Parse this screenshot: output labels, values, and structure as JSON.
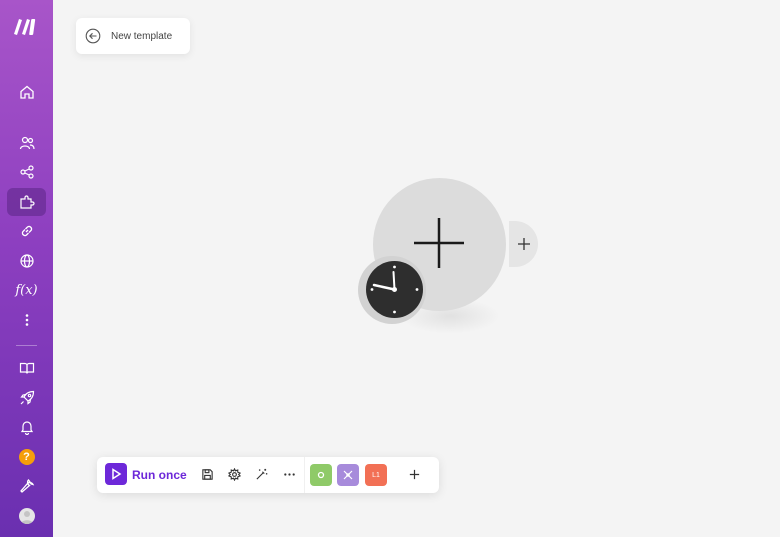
{
  "header": {
    "back_card_title": "New template"
  },
  "sidebar": {
    "items": [
      {
        "name": "home",
        "icon": "home-icon"
      },
      {
        "name": "team",
        "icon": "users-icon"
      },
      {
        "name": "scenarios",
        "icon": "share-icon"
      },
      {
        "name": "templates",
        "icon": "puzzle-icon",
        "active": true
      },
      {
        "name": "connections",
        "icon": "link-icon"
      },
      {
        "name": "webhooks",
        "icon": "globe-icon"
      },
      {
        "name": "functions",
        "icon": "function-icon",
        "label": "f(x)"
      },
      {
        "name": "more",
        "icon": "more-vertical-icon"
      },
      {
        "name": "docs",
        "icon": "book-icon"
      },
      {
        "name": "whats-new",
        "icon": "rocket-icon"
      },
      {
        "name": "notifications",
        "icon": "bell-icon"
      },
      {
        "name": "help",
        "icon": "help-icon",
        "label": "?"
      },
      {
        "name": "settings",
        "icon": "wrench-icon"
      },
      {
        "name": "profile",
        "icon": "avatar-icon"
      }
    ]
  },
  "toolbar": {
    "run_once_label": "Run once",
    "tags": [
      "",
      "",
      "L1"
    ]
  },
  "colors": {
    "accent": "#6d28d9",
    "tag_green": "#8fca68",
    "tag_purple": "#a78bdb",
    "tag_orange": "#f27055"
  }
}
